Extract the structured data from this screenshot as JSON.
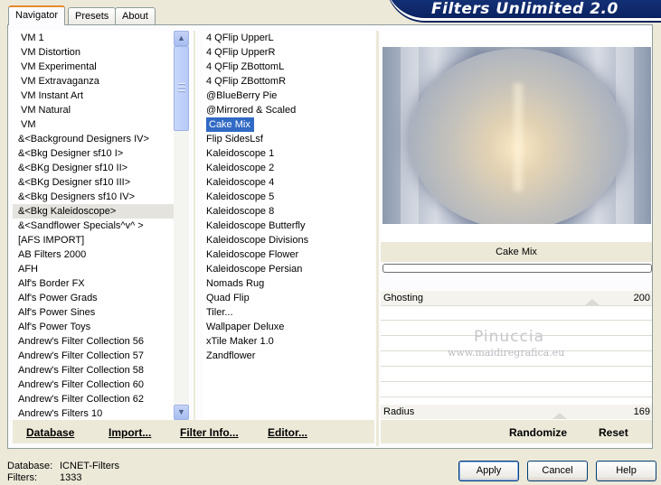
{
  "app": {
    "title": "Filters Unlimited 2.0"
  },
  "tabs": [
    {
      "label": "Navigator"
    },
    {
      "label": "Presets"
    },
    {
      "label": "About"
    }
  ],
  "categories": [
    "VM 1",
    "VM Distortion",
    "VM Experimental",
    "VM Extravaganza",
    "VM Instant Art",
    "VM Natural",
    "VM",
    "&<Background Designers IV>",
    "&<Bkg Designer sf10 I>",
    "&<BKg Designer sf10 II>",
    "&<BKg Designer sf10 III>",
    "&<Bkg Designers sf10 IV>",
    "&<Bkg Kaleidoscope>",
    "&<Sandflower Specials^v^ >",
    "[AFS IMPORT]",
    "AB Filters 2000",
    "AFH",
    "Alf's Border FX",
    "Alf's Power Grads",
    "Alf's Power Sines",
    "Alf's Power Toys",
    "Andrew's Filter Collection 56",
    "Andrew's Filter Collection 57",
    "Andrew's Filter Collection 58",
    "Andrew's Filter Collection 60",
    "Andrew's Filter Collection 62",
    "Andrew's Filters 10"
  ],
  "selected_category": "&<Bkg Kaleidoscope>",
  "filters": [
    "4 QFlip UpperL",
    "4 QFlip UpperR",
    "4 QFlip ZBottomL",
    "4 QFlip ZBottomR",
    "@BlueBerry Pie",
    "@Mirrored & Scaled",
    "Cake Mix",
    "Flip SidesLsf",
    "Kaleidoscope 1",
    "Kaleidoscope 2",
    "Kaleidoscope 4",
    "Kaleidoscope 5",
    "Kaleidoscope 8",
    "Kaleidoscope Butterfly",
    "Kaleidoscope Divisions",
    "Kaleidoscope Flower",
    "Kaleidoscope Persian",
    "Nomads Rug",
    "Quad Flip",
    "Tiler...",
    "Wallpaper Deluxe",
    "xTile Maker 1.0",
    "Zandflower"
  ],
  "selected_filter": "Cake Mix",
  "preview": {
    "filter_name": "Cake Mix",
    "progress": 0
  },
  "sliders": [
    {
      "name": "Ghosting",
      "value": "200"
    },
    {
      "name": "Radius",
      "value": "169"
    }
  ],
  "watermark": {
    "line1": "Pinuccia",
    "line2": "www.maidiregrafica.eu"
  },
  "left_buttons": {
    "database": "Database",
    "import": "Import...",
    "filter_info": "Filter Info...",
    "editor": "Editor..."
  },
  "right_buttons": {
    "randomize": "Randomize",
    "reset": "Reset"
  },
  "status": {
    "database_label": "Database:",
    "database_value": "ICNET-Filters",
    "filters_label": "Filters:",
    "filters_value": "1333"
  },
  "dialog_buttons": {
    "apply": "Apply",
    "cancel": "Cancel",
    "help": "Help"
  },
  "colors": {
    "selection": "#316ac5",
    "banner": "#0a2260",
    "window": "#ece9d8"
  }
}
